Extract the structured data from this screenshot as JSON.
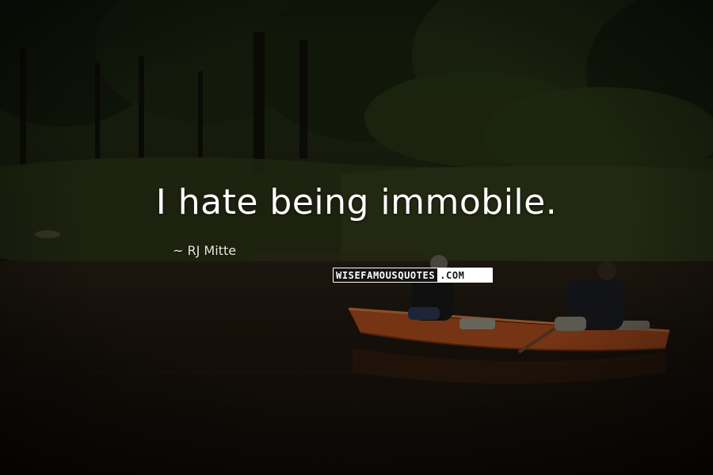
{
  "quote": {
    "text": "I hate being immobile.",
    "author": "~ RJ Mitte"
  },
  "watermark": {
    "left": "WISEFAMOUSQUOTES",
    "right": ".COM"
  },
  "colors": {
    "text": "#ffffff",
    "canoe": "#b4511f",
    "water": "#1e1710",
    "forest": "#1c2412"
  }
}
